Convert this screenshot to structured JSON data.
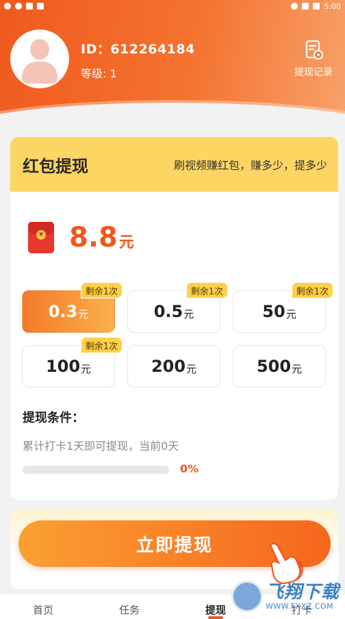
{
  "status_bar": {
    "time": "5:00"
  },
  "profile": {
    "id_text": "ID：612264184",
    "level_text": "等级: 1"
  },
  "header_actions": {
    "withdraw_record_label": "提现记录"
  },
  "card": {
    "title": "红包提现",
    "slogan": "刷视频赚红包，赚多少，提多少",
    "balance_value": "8.8",
    "balance_unit": "元"
  },
  "amount_options": [
    {
      "value": "0.3",
      "unit": "元",
      "badge": "剩余1次",
      "selected": true
    },
    {
      "value": "0.5",
      "unit": "元",
      "badge": "剩余1次",
      "selected": false
    },
    {
      "value": "50",
      "unit": "元",
      "badge": "剩余1次",
      "selected": false
    },
    {
      "value": "100",
      "unit": "元",
      "badge": "剩余1次",
      "selected": false
    },
    {
      "value": "200",
      "unit": "元",
      "badge": "",
      "selected": false
    },
    {
      "value": "500",
      "unit": "元",
      "badge": "",
      "selected": false
    }
  ],
  "condition": {
    "title": "提现条件：",
    "description": "累计打卡1天即可提现，当前0天",
    "progress_percent": 0,
    "progress_label": "0%"
  },
  "cta": {
    "label": "立即提现"
  },
  "tabs": [
    {
      "label": "首页",
      "active": false
    },
    {
      "label": "任务",
      "active": false
    },
    {
      "label": "提现",
      "active": true
    },
    {
      "label": "打卡",
      "active": false
    }
  ],
  "watermark": {
    "name": "飞翔下载",
    "url": "WWW.FXXZ.COM"
  },
  "colors": {
    "accent": "#f0571f",
    "banner": "#fdd562",
    "badge": "#fdd04a"
  }
}
